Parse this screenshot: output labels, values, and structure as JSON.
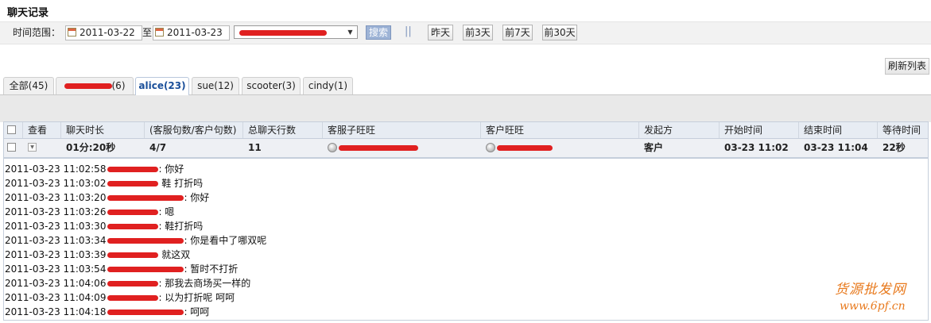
{
  "page_title": "聊天记录",
  "filter": {
    "label": "时间范围：",
    "date_from": "2011-03-22",
    "to_label": "至",
    "date_to": "2011-03-23",
    "search_label": "搜索",
    "separator": "||",
    "quick": [
      "昨天",
      "前3天",
      "前7天",
      "前30天"
    ]
  },
  "refresh_label": "刷新列表",
  "tabs": [
    {
      "label": "全部(45)"
    },
    {
      "label": "(6)"
    },
    {
      "label": "alice(23)"
    },
    {
      "label": "sue(12)"
    },
    {
      "label": "scooter(3)"
    },
    {
      "label": "cindy(1)"
    }
  ],
  "table": {
    "headers": [
      "查看",
      "聊天时长",
      "(客服句数/客户句数)",
      "总聊天行数",
      "客服子旺旺",
      "客户旺旺",
      "发起方",
      "开始时间",
      "结束时间",
      "等待时间"
    ],
    "row": {
      "duration": "01分:20秒",
      "ratio": "4/7",
      "lines": "11",
      "initiator": "客户",
      "start": "03-23 11:02",
      "end": "03-23 11:04",
      "wait": "22秒"
    }
  },
  "messages": [
    {
      "time": "2011-03-23 11:02:58",
      "text": ": 你好"
    },
    {
      "time": "2011-03-23 11:03:02",
      "text": " 鞋 打折吗"
    },
    {
      "time": "2011-03-23 11:03:20",
      "text": ": 你好"
    },
    {
      "time": "2011-03-23 11:03:26",
      "text": ": 嗯"
    },
    {
      "time": "2011-03-23 11:03:30",
      "text": ": 鞋打折吗"
    },
    {
      "time": "2011-03-23 11:03:34",
      "text": ": 你是看中了哪双呢"
    },
    {
      "time": "2011-03-23 11:03:39",
      "text": " 就这双"
    },
    {
      "time": "2011-03-23 11:03:54",
      "text": ": 暂时不打折"
    },
    {
      "time": "2011-03-23 11:04:06",
      "text": ": 那我去商场买一样的"
    },
    {
      "time": "2011-03-23 11:04:09",
      "text": ": 以为打折呢 呵呵"
    },
    {
      "time": "2011-03-23 11:04:18",
      "text": ": 呵呵"
    }
  ],
  "watermark": {
    "line1": "货源批发网",
    "line2": "www.6pf.cn"
  },
  "colors": {
    "redaction": "#e02020",
    "active_tab": "#1a4f9a",
    "watermark": "#e87a1e"
  }
}
